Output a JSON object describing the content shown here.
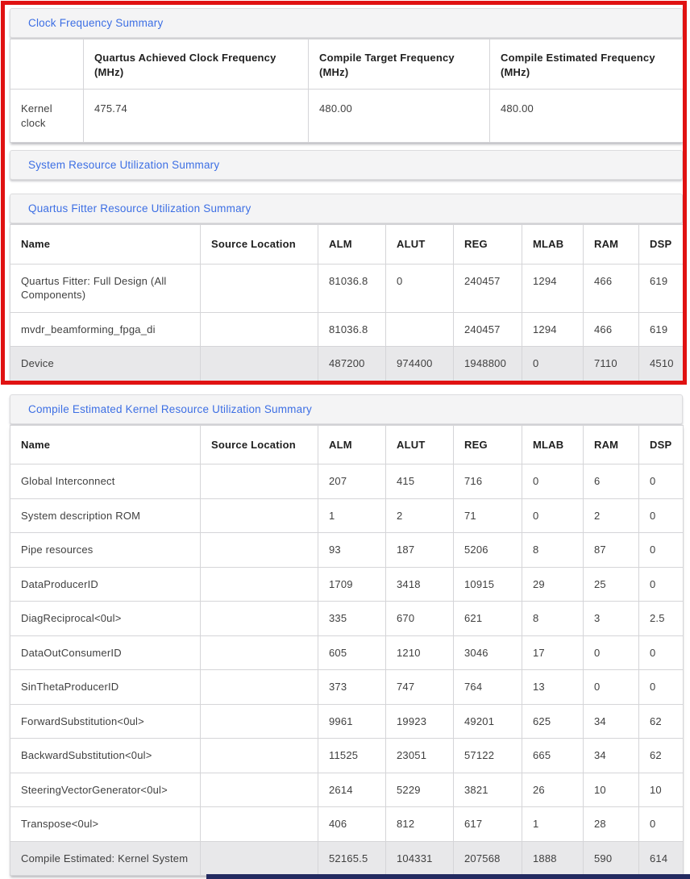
{
  "colors": {
    "link_blue": "#3D6FE4",
    "highlight_red": "#E01212",
    "row_highlight": "#E8E8EA",
    "section_bar_bg": "#F4F4F5",
    "navy_bar": "#232A60"
  },
  "clock_section": {
    "title": "Clock Frequency Summary",
    "columns": [
      "",
      "Quartus Achieved Clock Frequency (MHz)",
      "Compile Target Frequency (MHz)",
      "Compile Estimated Frequency (MHz)"
    ],
    "rows": [
      {
        "name": "Kernel clock",
        "values": [
          "475.74",
          "480.00",
          "480.00"
        ]
      }
    ]
  },
  "system_section": {
    "title": "System Resource Utilization Summary"
  },
  "fitter_section": {
    "title": "Quartus Fitter Resource Utilization Summary",
    "columns": [
      "Name",
      "Source Location",
      "ALM",
      "ALUT",
      "REG",
      "MLAB",
      "RAM",
      "DSP"
    ],
    "rows": [
      {
        "name": "Quartus Fitter: Full Design (All Components)",
        "source": "",
        "values": [
          "81036.8",
          "0",
          "240457",
          "1294",
          "466",
          "619"
        ],
        "highlight": false
      },
      {
        "name": "mvdr_beamforming_fpga_di",
        "source": "",
        "values": [
          "81036.8",
          "",
          "240457",
          "1294",
          "466",
          "619"
        ],
        "highlight": false
      },
      {
        "name": "Device",
        "source": "",
        "values": [
          "487200",
          "974400",
          "1948800",
          "0",
          "7110",
          "4510"
        ],
        "highlight": true
      }
    ]
  },
  "estimated_section": {
    "title": "Compile Estimated Kernel Resource Utilization Summary",
    "columns": [
      "Name",
      "Source Location",
      "ALM",
      "ALUT",
      "REG",
      "MLAB",
      "RAM",
      "DSP"
    ],
    "rows": [
      {
        "name": "Global Interconnect",
        "source": "",
        "values": [
          "207",
          "415",
          "716",
          "0",
          "6",
          "0"
        ],
        "highlight": false
      },
      {
        "name": "System description ROM",
        "source": "",
        "values": [
          "1",
          "2",
          "71",
          "0",
          "2",
          "0"
        ],
        "highlight": false
      },
      {
        "name": "Pipe resources",
        "source": "",
        "values": [
          "93",
          "187",
          "5206",
          "8",
          "87",
          "0"
        ],
        "highlight": false
      },
      {
        "name": "DataProducerID",
        "source": "",
        "values": [
          "1709",
          "3418",
          "10915",
          "29",
          "25",
          "0"
        ],
        "highlight": false
      },
      {
        "name": "DiagReciprocal<0ul>",
        "source": "",
        "values": [
          "335",
          "670",
          "621",
          "8",
          "3",
          "2.5"
        ],
        "highlight": false
      },
      {
        "name": "DataOutConsumerID",
        "source": "",
        "values": [
          "605",
          "1210",
          "3046",
          "17",
          "0",
          "0"
        ],
        "highlight": false
      },
      {
        "name": "SinThetaProducerID",
        "source": "",
        "values": [
          "373",
          "747",
          "764",
          "13",
          "0",
          "0"
        ],
        "highlight": false
      },
      {
        "name": "ForwardSubstitution<0ul>",
        "source": "",
        "values": [
          "9961",
          "19923",
          "49201",
          "625",
          "34",
          "62"
        ],
        "highlight": false
      },
      {
        "name": "BackwardSubstitution<0ul>",
        "source": "",
        "values": [
          "11525",
          "23051",
          "57122",
          "665",
          "34",
          "62"
        ],
        "highlight": false
      },
      {
        "name": "SteeringVectorGenerator<0ul>",
        "source": "",
        "values": [
          "2614",
          "5229",
          "3821",
          "26",
          "10",
          "10"
        ],
        "highlight": false
      },
      {
        "name": "Transpose<0ul>",
        "source": "",
        "values": [
          "406",
          "812",
          "617",
          "1",
          "28",
          "0"
        ],
        "highlight": false
      },
      {
        "name": "Compile Estimated: Kernel System",
        "source": "",
        "values": [
          "52165.5",
          "104331",
          "207568",
          "1888",
          "590",
          "614"
        ],
        "highlight": true
      }
    ]
  }
}
